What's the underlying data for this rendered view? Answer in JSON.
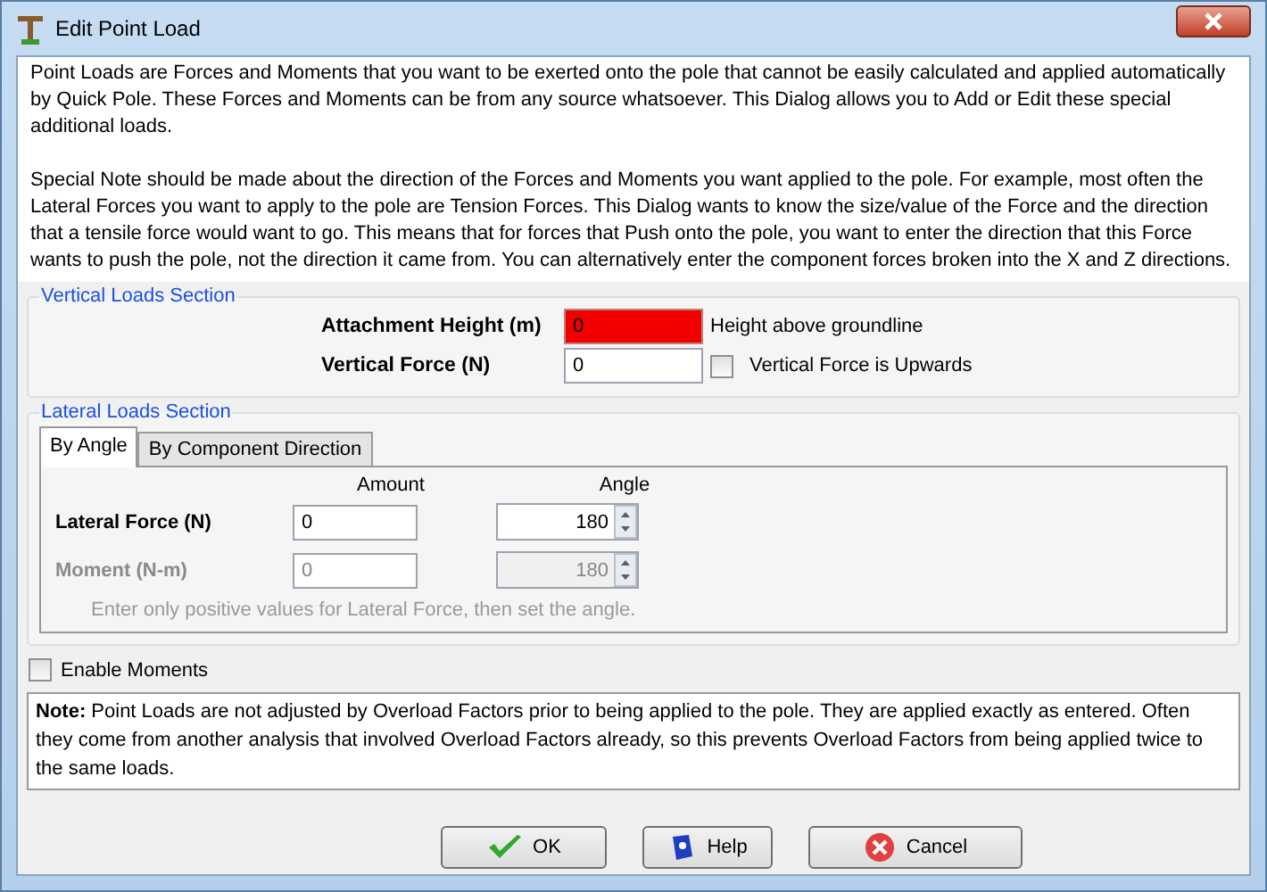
{
  "window": {
    "title": "Edit Point Load"
  },
  "intro": [
    "Point Loads are Forces and Moments that you want to be exerted onto the pole that cannot be easily calculated and applied automatically by Quick Pole. These Forces and Moments can be from any source whatsoever. This Dialog allows you to Add or Edit these special additional loads.",
    "Special Note should be made about the direction of the Forces and Moments you want applied to the pole. For example, most often the Lateral Forces you want to apply to the pole are Tension Forces. This Dialog wants to know the size/value of the Force and the direction that a tensile force would want to go. This means that for forces that Push onto the pole, you want to enter the direction that this Force wants to push the pole, not the direction it came from. You can alternatively enter the component forces broken into the X and Z directions."
  ],
  "vertical_section": {
    "legend": "Vertical Loads Section",
    "fields": [
      {
        "kind": "hint",
        "label": "Attachment Height (m)",
        "value": "0",
        "invalid": true,
        "hint": "Height above groundline"
      },
      {
        "kind": "checkbox",
        "label": "Vertical Force (N)",
        "value": "0",
        "invalid": false,
        "checkbox": {
          "label": "Vertical Force is Upwards",
          "checked": false
        }
      }
    ]
  },
  "lateral_section": {
    "legend": "Lateral Loads Section",
    "tabs": [
      {
        "label": "By Angle",
        "selected": true
      },
      {
        "label": "By Component Direction",
        "selected": false
      }
    ],
    "columns": [
      "Amount",
      "Angle"
    ],
    "rows": [
      {
        "label": "Lateral Force (N)",
        "amount": "0",
        "angle": "180",
        "disabled": false
      },
      {
        "label": "Moment (N-m)",
        "amount": "0",
        "angle": "180",
        "disabled": true
      }
    ],
    "hint": "Enter only positive values for Lateral Force, then set the angle."
  },
  "enable_moments": {
    "label": "Enable Moments",
    "checked": false
  },
  "note": "**Note:** Point Loads are not adjusted by Overload Factors prior to being applied to the pole. They are applied exactly as entered. Often they come from another analysis that involved Overload Factors already, so this prevents Overload Factors from being applied twice to the same loads.",
  "buttons": [
    {
      "kind": "ok",
      "label": "OK"
    },
    {
      "kind": "help",
      "label": "Help"
    },
    {
      "kind": "cancel",
      "label": "Cancel"
    }
  ]
}
